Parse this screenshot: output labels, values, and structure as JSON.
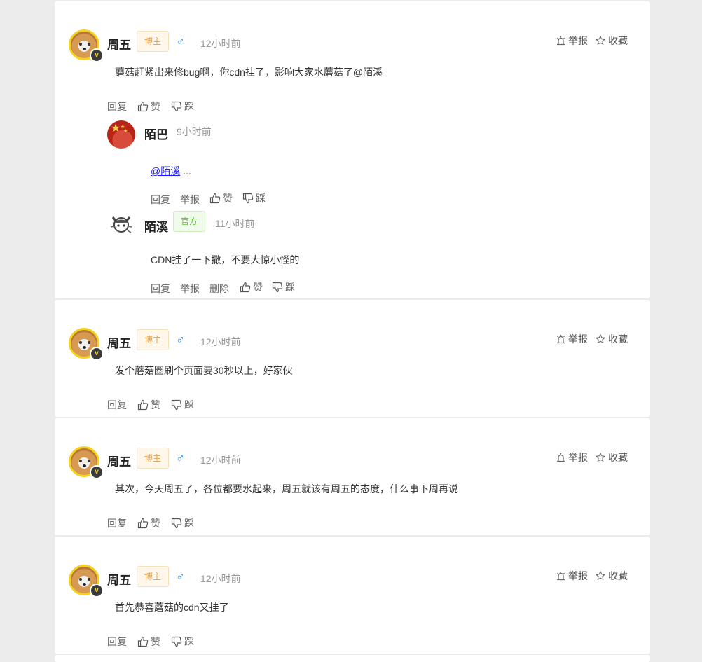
{
  "colors": {
    "host_tag": "#e3a24f",
    "official_tag": "#5fbf3e",
    "male": "#2e8ee8",
    "avatar_ring": "#f6d21c"
  },
  "icons": [
    "report-icon",
    "star-icon",
    "thumb-up-icon",
    "thumb-down-icon",
    "male-icon",
    "vip-badge-icon"
  ],
  "common": {
    "report": "举报",
    "favorite": "收藏",
    "reply": "回复",
    "like": "赞",
    "dislike": "踩",
    "delete": "删除",
    "vip": "v",
    "male": "♂"
  },
  "comments": [
    {
      "user": "周五",
      "tag": "博主",
      "time": "12小时前",
      "text": "蘑菇赶紧出来修bug啊，你cdn挂了，影响大家水蘑菇了@陌溪",
      "replies": [
        {
          "user": "陌巴",
          "time": "9小时前",
          "mention": "@陌溪",
          "text": " ..."
        },
        {
          "user": "陌溪",
          "tag": "官方",
          "time": "11小时前",
          "text": "CDN挂了一下撒，不要大惊小怪的"
        }
      ]
    },
    {
      "user": "周五",
      "tag": "博主",
      "time": "12小时前",
      "text": "发个蘑菇圈刷个页面要30秒以上，好家伙"
    },
    {
      "user": "周五",
      "tag": "博主",
      "time": "12小时前",
      "text": "其次，今天周五了，各位都要水起来，周五就该有周五的态度，什么事下周再说"
    },
    {
      "user": "周五",
      "tag": "博主",
      "time": "12小时前",
      "text": "首先恭喜蘑菇的cdn又挂了"
    }
  ]
}
